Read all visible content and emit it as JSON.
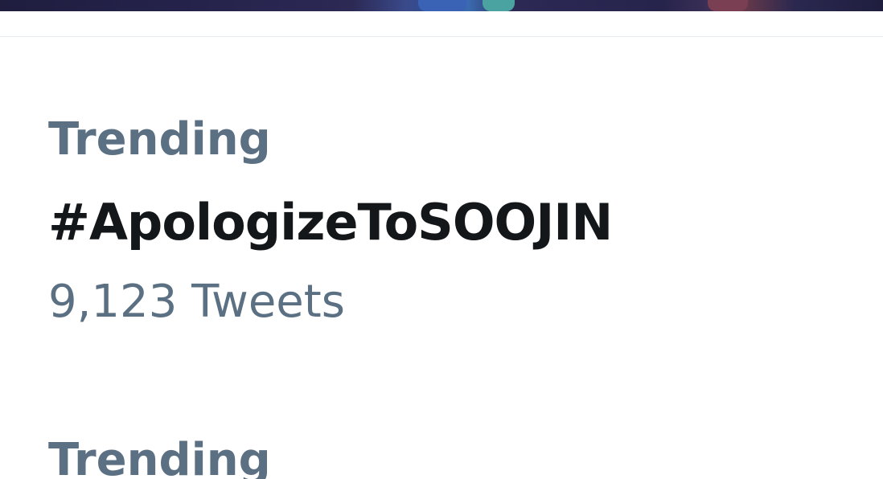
{
  "trends": [
    {
      "label": "Trending",
      "topic": "#ApologizeToSOOJIN",
      "count": "9,123 Tweets"
    },
    {
      "label": "Trending"
    }
  ],
  "colors": {
    "secondary_text": "#5b7083",
    "primary_text": "#14171a",
    "divider": "#e6ecf0",
    "background": "#ffffff"
  }
}
